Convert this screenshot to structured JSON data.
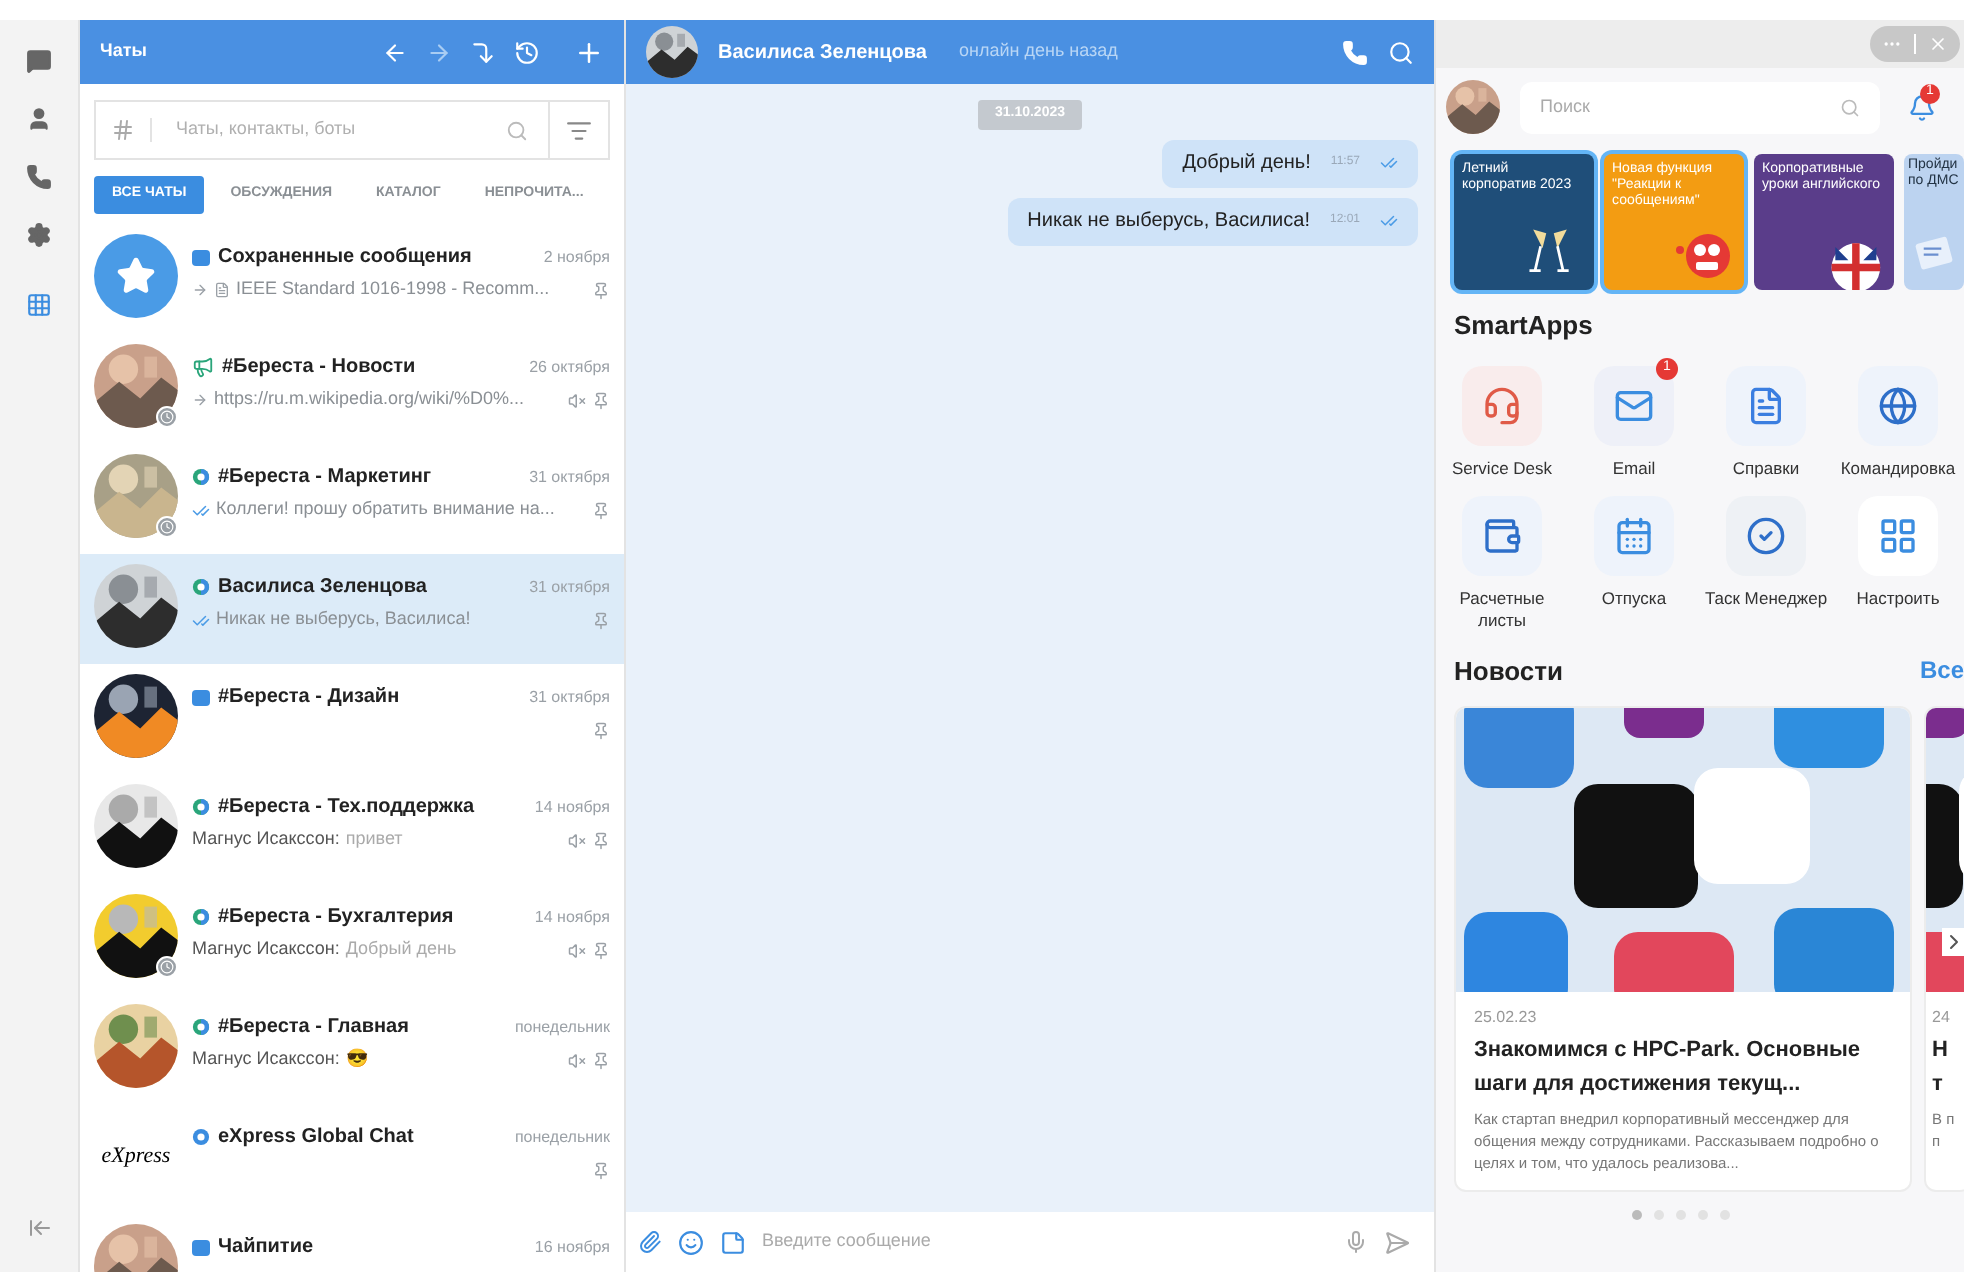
{
  "rail": {
    "items": [
      {
        "kind": "chats",
        "selected": false
      },
      {
        "kind": "contacts",
        "selected": false
      },
      {
        "kind": "calls",
        "selected": false
      },
      {
        "kind": "settings",
        "selected": false
      },
      {
        "kind": "apps",
        "selected": true
      }
    ]
  },
  "chat_list": {
    "title": "Чаты",
    "search": {
      "placeholder": "Чаты, контакты, боты"
    },
    "tabs": [
      {
        "label": "ВСЕ ЧАТЫ",
        "selected": true
      },
      {
        "label": "ОБСУЖДЕНИЯ",
        "selected": false
      },
      {
        "label": "КАТАЛОГ",
        "selected": false
      },
      {
        "label": "НЕПРОЧИТА...",
        "selected": false
      }
    ],
    "chats": [
      {
        "kind": "saved",
        "name": "Сохраненные сообщения",
        "date": "2 ноября",
        "forwarded": true,
        "read": false,
        "file": true,
        "preview": "IEEE Standard 1016-1998 - Recomm...",
        "muted": false,
        "pinned": true,
        "badge": false,
        "selected": false
      },
      {
        "kind": "channel",
        "name": "#Береста - Новости",
        "date": "26 октября",
        "forwarded": true,
        "read": false,
        "file": false,
        "preview": "https://ru.m.wikipedia.org/wiki/%D0%...",
        "muted": true,
        "pinned": true,
        "badge": true,
        "selected": false
      },
      {
        "kind": "group",
        "name": "#Береста - Маркетинг",
        "date": "31 октября",
        "forwarded": false,
        "read": true,
        "file": false,
        "preview": "Коллеги! прошу обратить внимание на...",
        "muted": false,
        "pinned": true,
        "badge": true,
        "selected": false
      },
      {
        "kind": "group",
        "name": "Василиса Зеленцова",
        "date": "31 октября",
        "forwarded": false,
        "read": true,
        "file": false,
        "preview": "Никак не выберусь, Василиса!",
        "muted": false,
        "pinned": true,
        "badge": false,
        "selected": true
      },
      {
        "kind": "chat",
        "name": "#Береста - Дизайн",
        "date": "31 октября",
        "muted": false,
        "pinned": true,
        "badge": false,
        "selected": false
      },
      {
        "kind": "group",
        "name": "#Береста - Тех.поддержка",
        "date": "14 ноября",
        "sender": "Магнус Исакссон:",
        "preview": "привет",
        "muted": true,
        "pinned": true,
        "badge": false,
        "selected": false
      },
      {
        "kind": "group",
        "name": "#Береста - Бухгалтерия",
        "date": "14 ноября",
        "sender": "Магнус Исакссон:",
        "preview": "Добрый день",
        "muted": true,
        "pinned": true,
        "badge": true,
        "selected": false
      },
      {
        "kind": "group",
        "name": "#Береста - Главная",
        "date": "понедельник",
        "sender": "Магнус Исакссон:",
        "preview": "😎",
        "muted": true,
        "pinned": true,
        "badge": false,
        "selected": false
      },
      {
        "kind": "global",
        "logo_text": "eXpress",
        "name": "eXpress Global Chat",
        "date": "понедельник",
        "muted": false,
        "pinned": true,
        "badge": false,
        "selected": false
      },
      {
        "kind": "chat",
        "name": "Чайпитие",
        "date": "16 ноября",
        "muted": false,
        "pinned": false,
        "badge": false,
        "selected": false
      }
    ]
  },
  "conversation": {
    "name": "Василиса Зеленцова",
    "status": "онлайн день назад",
    "date_separator": "31.10.2023",
    "messages": [
      {
        "text": "Добрый день!",
        "time": "11:57",
        "read": true
      },
      {
        "text": "Никак не выберусь, Василиса!",
        "time": "12:01",
        "read": true
      }
    ],
    "composer": {
      "placeholder": "Введите сообщение"
    }
  },
  "side_panel": {
    "search": {
      "placeholder": "Поиск"
    },
    "notifications": "1",
    "banners": [
      {
        "title": "Летний корпоратив 2023",
        "kind": "glasses",
        "selected": true
      },
      {
        "title": "Новая функция \"Реакции к сообщениям\"",
        "kind": "emoji",
        "selected": true
      },
      {
        "title": "Корпоративные уроки английского",
        "kind": "flag",
        "selected": false
      },
      {
        "title": "Пройди по ДМС",
        "kind": "document",
        "selected": false
      }
    ],
    "smartapps_title": "SmartApps",
    "apps": [
      {
        "kind": "service",
        "label": "Service Desk"
      },
      {
        "kind": "email",
        "label": "Email",
        "badge": "1"
      },
      {
        "kind": "docs",
        "label": "Справки"
      },
      {
        "kind": "trip",
        "label": "Командировка"
      },
      {
        "kind": "payslip",
        "label": "Расчетные листы"
      },
      {
        "kind": "vacation",
        "label": "Отпуска"
      },
      {
        "kind": "tasks",
        "label": "Таск Менеджер"
      },
      {
        "kind": "setup",
        "label": "Настроить"
      }
    ],
    "news_title": "Новости",
    "news_link": "Все",
    "news": [
      {
        "date": "25.02.23",
        "title": "Знакомимся с HPC-Park. Основные шаги для достижения текущ...",
        "text": "Как стартап внедрил корпоративный мессенджер для общения между сотрудниками. Рассказываем подробно о целях и том, что удалось реализова..."
      },
      {
        "date": "24",
        "title": "Н т",
        "text": "В п п"
      }
    ],
    "pages": [
      {
        "selected": true
      },
      {
        "selected": false
      },
      {
        "selected": false
      },
      {
        "selected": false
      },
      {
        "selected": false
      }
    ]
  }
}
